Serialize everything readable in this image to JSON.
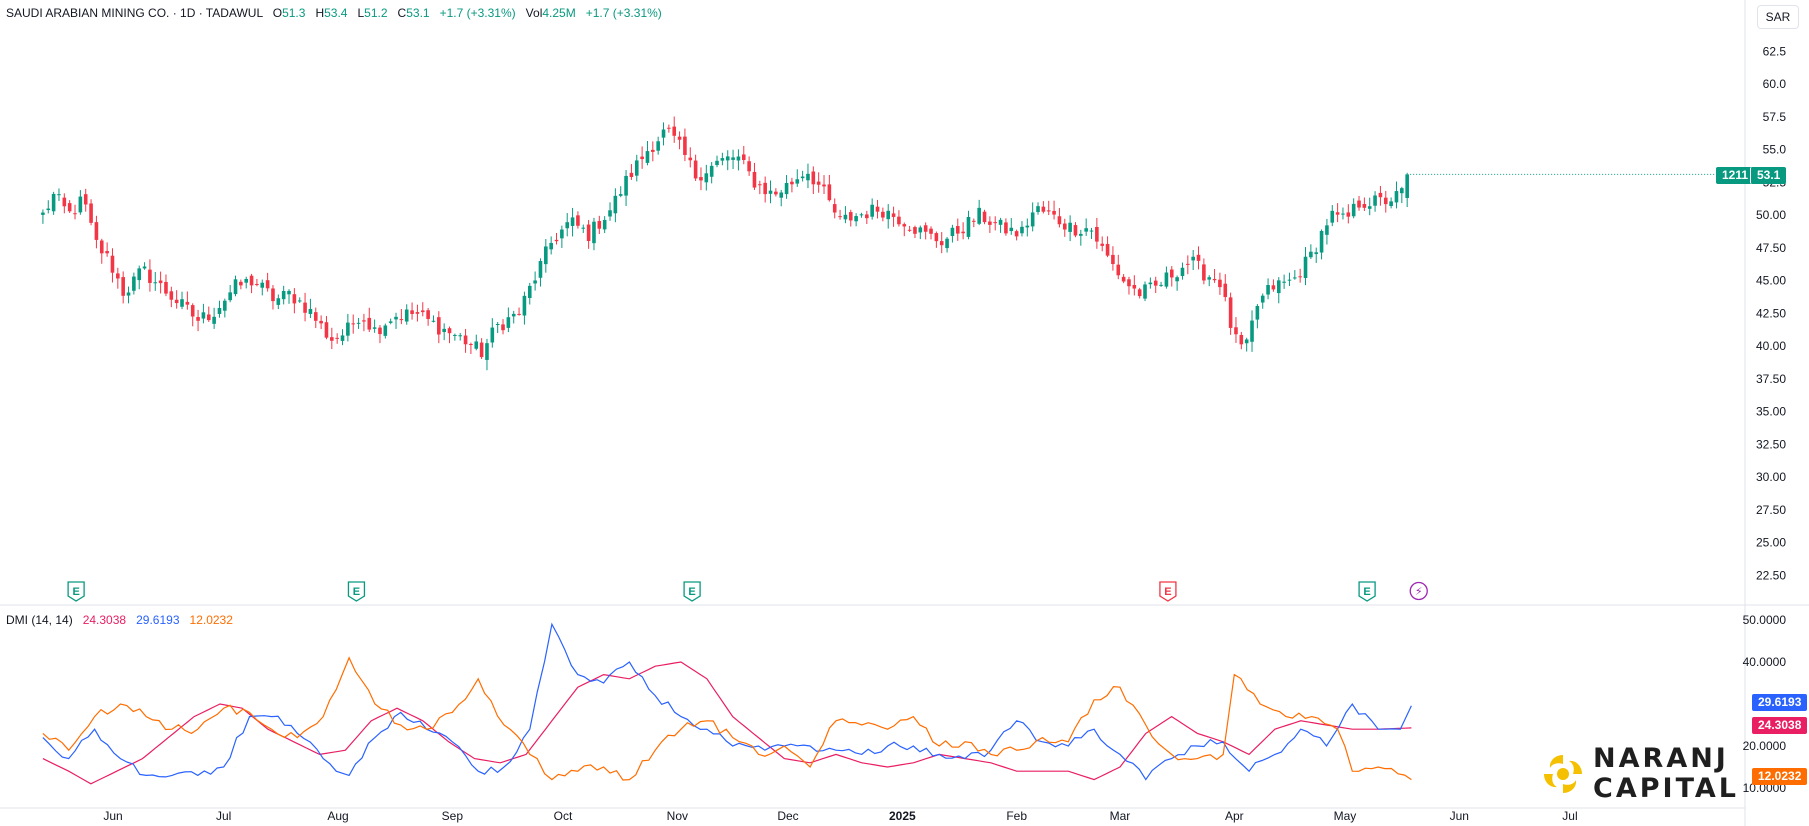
{
  "header": {
    "symbol": "SAUDI ARABIAN MINING CO. · 1D · TADAWUL",
    "o_label": "O",
    "o_value": "51.3",
    "h_label": "H",
    "h_value": "53.4",
    "l_label": "L",
    "l_value": "51.2",
    "c_label": "C",
    "c_value": "53.1",
    "change": "+1.7 (+3.31%)",
    "vol_label": "Vol",
    "vol_value": "4.25M",
    "vol_change": "+1.7 (+3.31%)"
  },
  "currency": "SAR",
  "price_tag": {
    "symbol_code": "1211",
    "price": "53.1"
  },
  "dmi": {
    "label": "DMI (14, 14)",
    "adx_value": "24.3038",
    "plus_di_value": "29.6193",
    "minus_di_value": "12.0232"
  },
  "colors": {
    "up": "#089981",
    "down": "#f23645",
    "adx": "#e91e63",
    "plus_di": "#2962ff",
    "minus_di": "#ff6d00",
    "earnings_up": "#089981",
    "earnings_down": "#f23645",
    "dividend": "#9c27b0"
  },
  "logo": {
    "line1": "NARANJ",
    "line2": "CAPITAL"
  },
  "chart_data": [
    {
      "type": "candlestick",
      "title": "SAUDI ARABIAN MINING CO. · 1D · TADAWUL",
      "yaxis_ticks": [
        "62.5",
        "60.0",
        "57.5",
        "55.0",
        "52.5",
        "50.00",
        "47.50",
        "45.00",
        "42.50",
        "40.00",
        "37.50",
        "35.00",
        "32.50",
        "30.00",
        "27.50",
        "25.00",
        "22.50"
      ],
      "ylim": [
        20.0,
        65.0
      ],
      "xaxis_ticks": [
        "Jun",
        "Jul",
        "Aug",
        "Sep",
        "Oct",
        "Nov",
        "Dec",
        "2025",
        "Feb",
        "Mar",
        "Apr",
        "May",
        "Jun",
        "Jul"
      ],
      "close_path": [
        [
          "2024-05-13",
          50.0
        ],
        [
          "2024-05-16",
          51.5
        ],
        [
          "2024-05-20",
          50.0
        ],
        [
          "2024-05-24",
          51.2
        ],
        [
          "2024-05-27",
          48.0
        ],
        [
          "2024-05-31",
          46.5
        ],
        [
          "2024-06-04",
          44.0
        ],
        [
          "2024-06-09",
          45.8
        ],
        [
          "2024-06-14",
          44.5
        ],
        [
          "2024-06-18",
          43.5
        ],
        [
          "2024-06-24",
          42.0
        ],
        [
          "2024-06-28",
          42.5
        ],
        [
          "2024-07-04",
          44.5
        ],
        [
          "2024-07-09",
          45.0
        ],
        [
          "2024-07-15",
          43.5
        ],
        [
          "2024-07-19",
          44.0
        ],
        [
          "2024-07-24",
          42.8
        ],
        [
          "2024-07-30",
          40.5
        ],
        [
          "2024-08-03",
          41.0
        ],
        [
          "2024-08-07",
          42.5
        ],
        [
          "2024-08-11",
          41.2
        ],
        [
          "2024-08-16",
          42.3
        ],
        [
          "2024-08-22",
          42.5
        ],
        [
          "2024-08-28",
          41.5
        ],
        [
          "2024-09-04",
          40.5
        ],
        [
          "2024-09-09",
          39.5
        ],
        [
          "2024-09-13",
          41.5
        ],
        [
          "2024-09-19",
          42.5
        ],
        [
          "2024-09-23",
          45.0
        ],
        [
          "2024-09-28",
          48.0
        ],
        [
          "2024-10-03",
          49.5
        ],
        [
          "2024-10-08",
          48.5
        ],
        [
          "2024-10-14",
          50.5
        ],
        [
          "2024-10-19",
          53.0
        ],
        [
          "2024-10-24",
          55.0
        ],
        [
          "2024-10-29",
          56.5
        ],
        [
          "2024-11-02",
          55.0
        ],
        [
          "2024-11-06",
          53.0
        ],
        [
          "2024-11-12",
          54.0
        ],
        [
          "2024-11-17",
          54.5
        ],
        [
          "2024-11-22",
          52.5
        ],
        [
          "2024-11-27",
          51.5
        ],
        [
          "2024-12-02",
          52.5
        ],
        [
          "2024-12-06",
          53.5
        ],
        [
          "2024-12-10",
          52.0
        ],
        [
          "2024-12-15",
          49.5
        ],
        [
          "2024-12-20",
          50.0
        ],
        [
          "2024-12-26",
          50.5
        ],
        [
          "2025-01-02",
          49.5
        ],
        [
          "2025-01-07",
          48.5
        ],
        [
          "2025-01-12",
          48.0
        ],
        [
          "2025-01-17",
          49.0
        ],
        [
          "2025-01-22",
          50.0
        ],
        [
          "2025-01-28",
          49.0
        ],
        [
          "2025-02-02",
          48.5
        ],
        [
          "2025-02-06",
          50.5
        ],
        [
          "2025-02-10",
          50.0
        ],
        [
          "2025-02-16",
          49.0
        ],
        [
          "2025-02-21",
          49.0
        ],
        [
          "2025-02-25",
          47.0
        ],
        [
          "2025-03-02",
          45.0
        ],
        [
          "2025-03-06",
          44.0
        ],
        [
          "2025-03-11",
          44.5
        ],
        [
          "2025-03-15",
          45.5
        ],
        [
          "2025-03-20",
          46.5
        ],
        [
          "2025-03-24",
          45.5
        ],
        [
          "2025-03-28",
          45.0
        ],
        [
          "2025-04-01",
          40.5
        ],
        [
          "2025-04-04",
          39.5
        ],
        [
          "2025-04-07",
          43.0
        ],
        [
          "2025-04-11",
          44.5
        ],
        [
          "2025-04-17",
          45.0
        ],
        [
          "2025-04-22",
          47.0
        ],
        [
          "2025-04-27",
          50.0
        ],
        [
          "2025-05-01",
          49.5
        ],
        [
          "2025-05-05",
          51.0
        ],
        [
          "2025-05-11",
          51.0
        ],
        [
          "2025-05-16",
          51.5
        ],
        [
          "2025-05-19",
          53.1
        ]
      ]
    },
    {
      "type": "line",
      "title": "DMI (14, 14)",
      "yaxis_ticks": [
        "50.0000",
        "40.0000",
        "20.0000",
        "10.0000"
      ],
      "ylim": [
        10.0,
        50.0
      ],
      "series": [
        {
          "name": "ADX",
          "colorKey": "adx",
          "points": [
            [
              "2024-05-13",
              17
            ],
            [
              "2024-05-20",
              14
            ],
            [
              "2024-05-26",
              11
            ],
            [
              "2024-06-02",
              14
            ],
            [
              "2024-06-09",
              17
            ],
            [
              "2024-06-16",
              22
            ],
            [
              "2024-06-23",
              27
            ],
            [
              "2024-06-30",
              30
            ],
            [
              "2024-07-06",
              29
            ],
            [
              "2024-07-13",
              24
            ],
            [
              "2024-07-20",
              21
            ],
            [
              "2024-07-27",
              18
            ],
            [
              "2024-08-03",
              19
            ],
            [
              "2024-08-10",
              26
            ],
            [
              "2024-08-17",
              29
            ],
            [
              "2024-08-24",
              26
            ],
            [
              "2024-08-31",
              21
            ],
            [
              "2024-09-07",
              17
            ],
            [
              "2024-09-14",
              16
            ],
            [
              "2024-09-21",
              18
            ],
            [
              "2024-09-28",
              26
            ],
            [
              "2024-10-05",
              34
            ],
            [
              "2024-10-12",
              37
            ],
            [
              "2024-10-19",
              36
            ],
            [
              "2024-10-26",
              39
            ],
            [
              "2024-11-02",
              40
            ],
            [
              "2024-11-09",
              36
            ],
            [
              "2024-11-16",
              27
            ],
            [
              "2024-11-23",
              22
            ],
            [
              "2024-11-30",
              17
            ],
            [
              "2024-12-07",
              16
            ],
            [
              "2024-12-14",
              18
            ],
            [
              "2024-12-21",
              16
            ],
            [
              "2024-12-28",
              15
            ],
            [
              "2025-01-04",
              16
            ],
            [
              "2025-01-11",
              18
            ],
            [
              "2025-01-18",
              17
            ],
            [
              "2025-01-25",
              16
            ],
            [
              "2025-02-01",
              14
            ],
            [
              "2025-02-08",
              14
            ],
            [
              "2025-02-15",
              14
            ],
            [
              "2025-02-22",
              12
            ],
            [
              "2025-03-01",
              15
            ],
            [
              "2025-03-08",
              23
            ],
            [
              "2025-03-15",
              27
            ],
            [
              "2025-03-22",
              23
            ],
            [
              "2025-03-29",
              21
            ],
            [
              "2025-04-05",
              18
            ],
            [
              "2025-04-12",
              24
            ],
            [
              "2025-04-19",
              26
            ],
            [
              "2025-04-26",
              25
            ],
            [
              "2025-05-03",
              24
            ],
            [
              "2025-05-10",
              24
            ],
            [
              "2025-05-19",
              24.3
            ]
          ]
        },
        {
          "name": "+DI",
          "colorKey": "plus_di",
          "points": [
            [
              "2024-05-13",
              22
            ],
            [
              "2024-05-20",
              17
            ],
            [
              "2024-05-27",
              24
            ],
            [
              "2024-06-03",
              17
            ],
            [
              "2024-06-10",
              13
            ],
            [
              "2024-06-17",
              13
            ],
            [
              "2024-06-24",
              13
            ],
            [
              "2024-07-01",
              15
            ],
            [
              "2024-07-08",
              27
            ],
            [
              "2024-07-14",
              27
            ],
            [
              "2024-07-21",
              23
            ],
            [
              "2024-07-28",
              17
            ],
            [
              "2024-08-04",
              13
            ],
            [
              "2024-08-11",
              22
            ],
            [
              "2024-08-18",
              28
            ],
            [
              "2024-08-25",
              24
            ],
            [
              "2024-09-01",
              21
            ],
            [
              "2024-09-08",
              14
            ],
            [
              "2024-09-15",
              15
            ],
            [
              "2024-09-22",
              24
            ],
            [
              "2024-09-28",
              49
            ],
            [
              "2024-10-05",
              37
            ],
            [
              "2024-10-12",
              35
            ],
            [
              "2024-10-19",
              40
            ],
            [
              "2024-10-26",
              32
            ],
            [
              "2024-11-02",
              27
            ],
            [
              "2024-11-09",
              24
            ],
            [
              "2024-11-16",
              20
            ],
            [
              "2024-11-23",
              20
            ],
            [
              "2024-11-30",
              20
            ],
            [
              "2024-12-07",
              20
            ],
            [
              "2024-12-14",
              19
            ],
            [
              "2024-12-21",
              18
            ],
            [
              "2024-12-28",
              20
            ],
            [
              "2025-01-04",
              20
            ],
            [
              "2025-01-11",
              18
            ],
            [
              "2025-01-18",
              17
            ],
            [
              "2025-01-25",
              19
            ],
            [
              "2025-02-01",
              26
            ],
            [
              "2025-02-08",
              21
            ],
            [
              "2025-02-15",
              20
            ],
            [
              "2025-02-22",
              24
            ],
            [
              "2025-03-01",
              18
            ],
            [
              "2025-03-08",
              12
            ],
            [
              "2025-03-15",
              17
            ],
            [
              "2025-03-22",
              20
            ],
            [
              "2025-03-29",
              21
            ],
            [
              "2025-04-05",
              14
            ],
            [
              "2025-04-12",
              18
            ],
            [
              "2025-04-19",
              24
            ],
            [
              "2025-04-26",
              20
            ],
            [
              "2025-05-03",
              30
            ],
            [
              "2025-05-10",
              24
            ],
            [
              "2025-05-16",
              24
            ],
            [
              "2025-05-19",
              29.6
            ]
          ]
        },
        {
          "name": "-DI",
          "colorKey": "minus_di",
          "points": [
            [
              "2024-05-13",
              23
            ],
            [
              "2024-05-20",
              19
            ],
            [
              "2024-05-27",
              27
            ],
            [
              "2024-06-03",
              30
            ],
            [
              "2024-06-10",
              27
            ],
            [
              "2024-06-17",
              24
            ],
            [
              "2024-06-24",
              24
            ],
            [
              "2024-07-01",
              29
            ],
            [
              "2024-07-08",
              28
            ],
            [
              "2024-07-14",
              24
            ],
            [
              "2024-07-21",
              22
            ],
            [
              "2024-07-28",
              27
            ],
            [
              "2024-08-04",
              41
            ],
            [
              "2024-08-11",
              30
            ],
            [
              "2024-08-18",
              25
            ],
            [
              "2024-08-25",
              24
            ],
            [
              "2024-09-01",
              28
            ],
            [
              "2024-09-08",
              36
            ],
            [
              "2024-09-15",
              25
            ],
            [
              "2024-09-22",
              18
            ],
            [
              "2024-09-28",
              12
            ],
            [
              "2024-10-05",
              14
            ],
            [
              "2024-10-12",
              15
            ],
            [
              "2024-10-19",
              12
            ],
            [
              "2024-10-26",
              19
            ],
            [
              "2024-11-02",
              24
            ],
            [
              "2024-11-09",
              26
            ],
            [
              "2024-11-16",
              22
            ],
            [
              "2024-11-23",
              18
            ],
            [
              "2024-11-30",
              20
            ],
            [
              "2024-12-07",
              15
            ],
            [
              "2024-12-14",
              26
            ],
            [
              "2024-12-21",
              25
            ],
            [
              "2024-12-28",
              24
            ],
            [
              "2025-01-04",
              27
            ],
            [
              "2025-01-11",
              20
            ],
            [
              "2025-01-18",
              21
            ],
            [
              "2025-01-25",
              18
            ],
            [
              "2025-02-01",
              19
            ],
            [
              "2025-02-08",
              22
            ],
            [
              "2025-02-15",
              21
            ],
            [
              "2025-02-22",
              31
            ],
            [
              "2025-03-01",
              34
            ],
            [
              "2025-03-08",
              25
            ],
            [
              "2025-03-15",
              18
            ],
            [
              "2025-03-22",
              17
            ],
            [
              "2025-03-29",
              18
            ],
            [
              "2025-04-01",
              37
            ],
            [
              "2025-04-08",
              30
            ],
            [
              "2025-04-15",
              27
            ],
            [
              "2025-04-22",
              27
            ],
            [
              "2025-04-29",
              24
            ],
            [
              "2025-05-03",
              14
            ],
            [
              "2025-05-10",
              15
            ],
            [
              "2025-05-19",
              12.0
            ]
          ]
        }
      ]
    }
  ],
  "event_markers": [
    {
      "date": "2024-05-22",
      "label": "E",
      "kind": "earnings_up"
    },
    {
      "date": "2024-08-06",
      "label": "E",
      "kind": "earnings_up"
    },
    {
      "date": "2024-11-05",
      "label": "E",
      "kind": "earnings_up"
    },
    {
      "date": "2025-03-14",
      "label": "E",
      "kind": "earnings_down"
    },
    {
      "date": "2025-05-07",
      "label": "E",
      "kind": "earnings_up"
    },
    {
      "date": "2025-05-21",
      "label": "⚡",
      "kind": "dividend"
    }
  ]
}
